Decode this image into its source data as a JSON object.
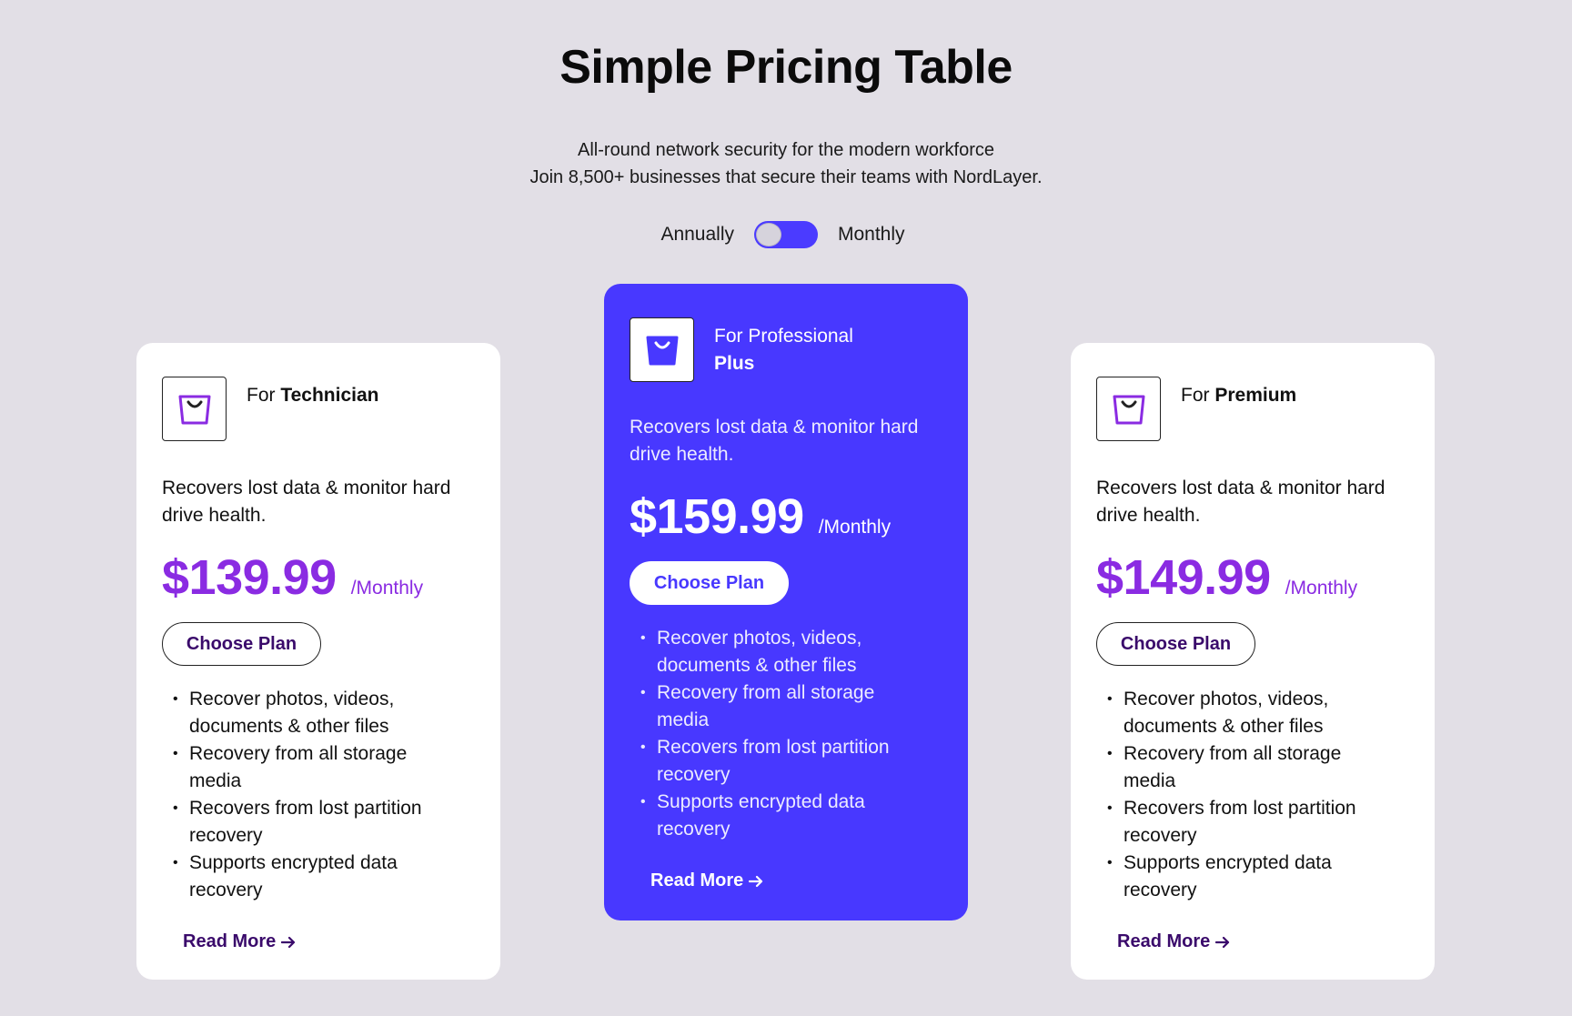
{
  "header": {
    "title": "Simple Pricing Table",
    "subtitle_line1": "All-round network security for the modern workforce",
    "subtitle_line2": "Join 8,500+ businesses that secure their teams with NordLayer."
  },
  "billing_toggle": {
    "left_label": "Annually",
    "right_label": "Monthly"
  },
  "colors": {
    "background": "#e2dfe6",
    "accent": "#4838ff",
    "price_purple": "#8a2be2",
    "button_text": "#3a0a6b"
  },
  "plans": [
    {
      "prefix": "For",
      "name": "Technician",
      "icon": "shopping-bag-icon",
      "description": "Recovers lost data & monitor hard drive health.",
      "price": "$139.99",
      "period": "/Monthly",
      "cta": "Choose Plan",
      "features": [
        "Recover photos, videos, documents & other files",
        "Recovery from all storage media",
        "Recovers from lost partition recovery",
        "Supports encrypted data recovery"
      ],
      "read_more": "Read More"
    },
    {
      "prefix": "For Professional",
      "name": "Plus",
      "icon": "shopping-bag-icon",
      "description": "Recovers lost data & monitor hard drive health.",
      "price": "$159.99",
      "period": "/Monthly",
      "cta": "Choose Plan",
      "features": [
        "Recover photos, videos, documents & other files",
        "Recovery from all storage media",
        "Recovers from lost partition recovery",
        "Supports encrypted data recovery"
      ],
      "read_more": "Read More"
    },
    {
      "prefix": "For",
      "name": "Premium",
      "icon": "shopping-bag-icon",
      "description": "Recovers lost data & monitor hard drive health.",
      "price": "$149.99",
      "period": "/Monthly",
      "cta": "Choose Plan",
      "features": [
        "Recover photos, videos, documents & other files",
        "Recovery from all storage media",
        "Recovers from lost partition recovery",
        "Supports encrypted data recovery"
      ],
      "read_more": "Read More"
    }
  ]
}
